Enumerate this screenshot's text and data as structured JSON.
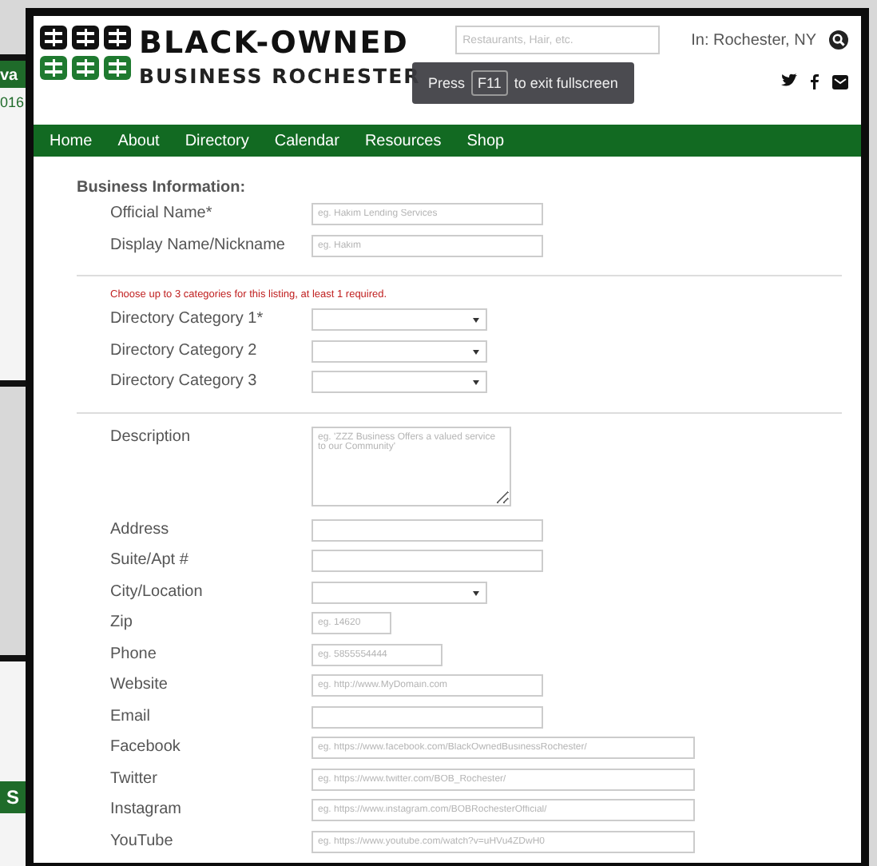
{
  "background_windows": [
    {
      "label": "va"
    },
    {
      "label": "016"
    },
    {
      "label": "S"
    }
  ],
  "header": {
    "logo": {
      "line_1": "BLACK-OWNED",
      "line_2": "BUSINESS ROCHESTER"
    },
    "search": {
      "placeholder": "Restaurants, Hair, etc."
    },
    "location": "In: Rochester, NY"
  },
  "nav": [
    "Home",
    "About",
    "Directory",
    "Calendar",
    "Resources",
    "Shop"
  ],
  "fullscreen_toast": {
    "before": "Press",
    "key": "F11",
    "after": "to exit fullscreen"
  },
  "form": {
    "title": "Business Information:",
    "groups": [
      {
        "fields": [
          {
            "label": "Official Name*",
            "kind": "text",
            "placeholder": "eg. Hakim Lending Services"
          },
          {
            "label": "Display Name/Nickname",
            "kind": "text",
            "placeholder": "eg. Hakim"
          }
        ]
      },
      {
        "note": "Choose up to 3 categories for this listing, at least 1 required.",
        "fields": [
          {
            "label": "Directory Category 1*",
            "kind": "select"
          },
          {
            "label": "Directory Category 2",
            "kind": "select"
          },
          {
            "label": "Directory Category 3",
            "kind": "select"
          }
        ]
      },
      {
        "fields": [
          {
            "label": "Description",
            "kind": "textarea",
            "placeholder": "eg. 'ZZZ Business Offers a valued service to our Community'"
          },
          {
            "label": "Address",
            "kind": "text"
          },
          {
            "label": "Suite/Apt #",
            "kind": "text"
          },
          {
            "label": "City/Location",
            "kind": "select"
          },
          {
            "label": "Zip",
            "kind": "zip",
            "placeholder": "eg. 14620"
          },
          {
            "label": "Phone",
            "kind": "phone",
            "placeholder": "eg. 5855554444"
          },
          {
            "label": "Website",
            "kind": "text",
            "placeholder": "eg. http://www.MyDomain.com"
          },
          {
            "label": "Email",
            "kind": "text"
          },
          {
            "label": "Facebook",
            "kind": "url",
            "placeholder": "eg. https://www.facebook.com/BlackOwnedBusinessRochester/"
          },
          {
            "label": "Twitter",
            "kind": "url",
            "placeholder": "eg. https://www.twitter.com/BOB_Rochester/"
          },
          {
            "label": "Instagram",
            "kind": "url",
            "placeholder": "eg. https://www.instagram.com/BOBRochesterOfficial/"
          },
          {
            "label": "YouTube",
            "kind": "url",
            "placeholder": "eg. https://www.youtube.com/watch?v=uHVu4ZDwH0"
          }
        ]
      }
    ]
  }
}
